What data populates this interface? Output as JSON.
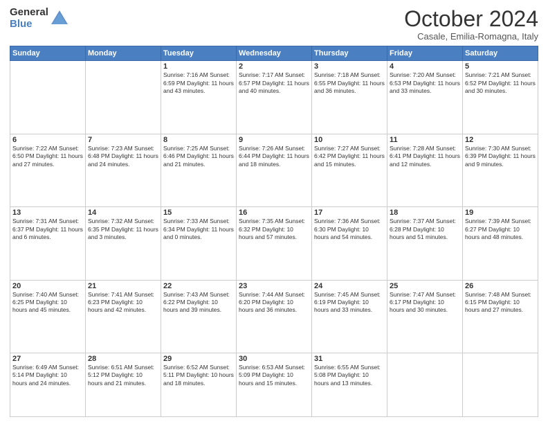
{
  "header": {
    "logo_line1": "General",
    "logo_line2": "Blue",
    "month": "October 2024",
    "location": "Casale, Emilia-Romagna, Italy"
  },
  "days_of_week": [
    "Sunday",
    "Monday",
    "Tuesday",
    "Wednesday",
    "Thursday",
    "Friday",
    "Saturday"
  ],
  "weeks": [
    [
      {
        "day": "",
        "info": ""
      },
      {
        "day": "",
        "info": ""
      },
      {
        "day": "1",
        "info": "Sunrise: 7:16 AM\nSunset: 6:59 PM\nDaylight: 11 hours and 43 minutes."
      },
      {
        "day": "2",
        "info": "Sunrise: 7:17 AM\nSunset: 6:57 PM\nDaylight: 11 hours and 40 minutes."
      },
      {
        "day": "3",
        "info": "Sunrise: 7:18 AM\nSunset: 6:55 PM\nDaylight: 11 hours and 36 minutes."
      },
      {
        "day": "4",
        "info": "Sunrise: 7:20 AM\nSunset: 6:53 PM\nDaylight: 11 hours and 33 minutes."
      },
      {
        "day": "5",
        "info": "Sunrise: 7:21 AM\nSunset: 6:52 PM\nDaylight: 11 hours and 30 minutes."
      }
    ],
    [
      {
        "day": "6",
        "info": "Sunrise: 7:22 AM\nSunset: 6:50 PM\nDaylight: 11 hours and 27 minutes."
      },
      {
        "day": "7",
        "info": "Sunrise: 7:23 AM\nSunset: 6:48 PM\nDaylight: 11 hours and 24 minutes."
      },
      {
        "day": "8",
        "info": "Sunrise: 7:25 AM\nSunset: 6:46 PM\nDaylight: 11 hours and 21 minutes."
      },
      {
        "day": "9",
        "info": "Sunrise: 7:26 AM\nSunset: 6:44 PM\nDaylight: 11 hours and 18 minutes."
      },
      {
        "day": "10",
        "info": "Sunrise: 7:27 AM\nSunset: 6:42 PM\nDaylight: 11 hours and 15 minutes."
      },
      {
        "day": "11",
        "info": "Sunrise: 7:28 AM\nSunset: 6:41 PM\nDaylight: 11 hours and 12 minutes."
      },
      {
        "day": "12",
        "info": "Sunrise: 7:30 AM\nSunset: 6:39 PM\nDaylight: 11 hours and 9 minutes."
      }
    ],
    [
      {
        "day": "13",
        "info": "Sunrise: 7:31 AM\nSunset: 6:37 PM\nDaylight: 11 hours and 6 minutes."
      },
      {
        "day": "14",
        "info": "Sunrise: 7:32 AM\nSunset: 6:35 PM\nDaylight: 11 hours and 3 minutes."
      },
      {
        "day": "15",
        "info": "Sunrise: 7:33 AM\nSunset: 6:34 PM\nDaylight: 11 hours and 0 minutes."
      },
      {
        "day": "16",
        "info": "Sunrise: 7:35 AM\nSunset: 6:32 PM\nDaylight: 10 hours and 57 minutes."
      },
      {
        "day": "17",
        "info": "Sunrise: 7:36 AM\nSunset: 6:30 PM\nDaylight: 10 hours and 54 minutes."
      },
      {
        "day": "18",
        "info": "Sunrise: 7:37 AM\nSunset: 6:28 PM\nDaylight: 10 hours and 51 minutes."
      },
      {
        "day": "19",
        "info": "Sunrise: 7:39 AM\nSunset: 6:27 PM\nDaylight: 10 hours and 48 minutes."
      }
    ],
    [
      {
        "day": "20",
        "info": "Sunrise: 7:40 AM\nSunset: 6:25 PM\nDaylight: 10 hours and 45 minutes."
      },
      {
        "day": "21",
        "info": "Sunrise: 7:41 AM\nSunset: 6:23 PM\nDaylight: 10 hours and 42 minutes."
      },
      {
        "day": "22",
        "info": "Sunrise: 7:43 AM\nSunset: 6:22 PM\nDaylight: 10 hours and 39 minutes."
      },
      {
        "day": "23",
        "info": "Sunrise: 7:44 AM\nSunset: 6:20 PM\nDaylight: 10 hours and 36 minutes."
      },
      {
        "day": "24",
        "info": "Sunrise: 7:45 AM\nSunset: 6:19 PM\nDaylight: 10 hours and 33 minutes."
      },
      {
        "day": "25",
        "info": "Sunrise: 7:47 AM\nSunset: 6:17 PM\nDaylight: 10 hours and 30 minutes."
      },
      {
        "day": "26",
        "info": "Sunrise: 7:48 AM\nSunset: 6:15 PM\nDaylight: 10 hours and 27 minutes."
      }
    ],
    [
      {
        "day": "27",
        "info": "Sunrise: 6:49 AM\nSunset: 5:14 PM\nDaylight: 10 hours and 24 minutes."
      },
      {
        "day": "28",
        "info": "Sunrise: 6:51 AM\nSunset: 5:12 PM\nDaylight: 10 hours and 21 minutes."
      },
      {
        "day": "29",
        "info": "Sunrise: 6:52 AM\nSunset: 5:11 PM\nDaylight: 10 hours and 18 minutes."
      },
      {
        "day": "30",
        "info": "Sunrise: 6:53 AM\nSunset: 5:09 PM\nDaylight: 10 hours and 15 minutes."
      },
      {
        "day": "31",
        "info": "Sunrise: 6:55 AM\nSunset: 5:08 PM\nDaylight: 10 hours and 13 minutes."
      },
      {
        "day": "",
        "info": ""
      },
      {
        "day": "",
        "info": ""
      }
    ]
  ]
}
